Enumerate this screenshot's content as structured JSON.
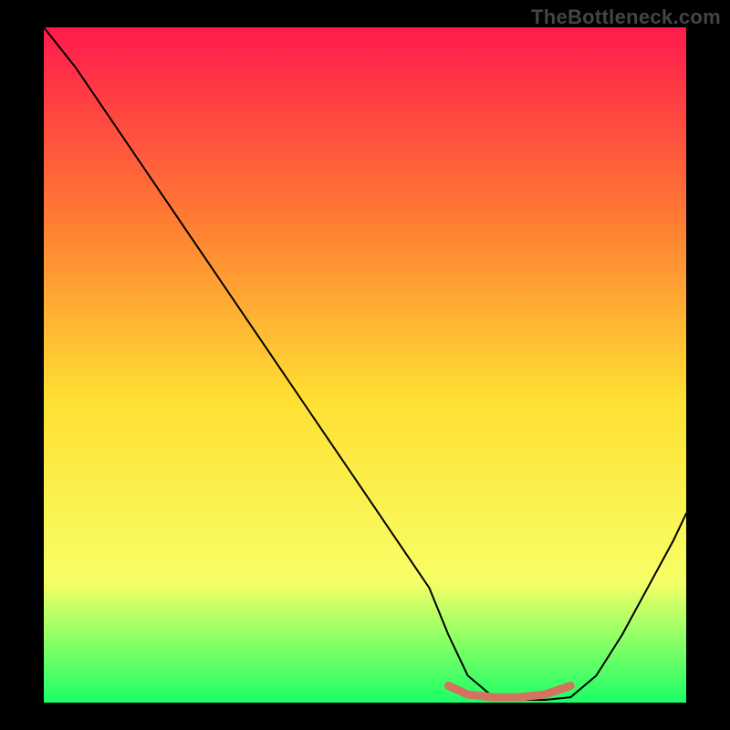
{
  "watermark": "TheBottleneck.com",
  "chart_data": {
    "type": "line",
    "title": "",
    "xlabel": "",
    "ylabel": "",
    "xlim": [
      0,
      100
    ],
    "ylim": [
      0,
      100
    ],
    "grid": false,
    "background_gradient": {
      "top": "#ff1a4d",
      "mid_upper": "#ff7a33",
      "mid": "#ffe033",
      "mid_lower": "#f7ff66",
      "bottom": "#1aff66"
    },
    "series": [
      {
        "name": "bottleneck-curve",
        "color": "#000000",
        "stroke_width": 2,
        "x": [
          0,
          5,
          10,
          15,
          20,
          25,
          30,
          35,
          40,
          45,
          50,
          55,
          60,
          63,
          66,
          70,
          74,
          78,
          82,
          86,
          90,
          94,
          98,
          100
        ],
        "y": [
          100,
          94,
          87,
          80,
          73,
          66,
          59,
          52,
          45,
          38,
          31,
          24,
          17,
          10,
          4,
          0.8,
          0.4,
          0.4,
          0.8,
          4,
          10,
          17,
          24,
          28
        ]
      },
      {
        "name": "flat-region-highlight",
        "color": "#d2735f",
        "stroke_width": 9,
        "x": [
          63,
          66,
          70,
          74,
          78,
          82
        ],
        "y": [
          2.5,
          1.2,
          0.8,
          0.8,
          1.2,
          2.5
        ]
      }
    ]
  }
}
